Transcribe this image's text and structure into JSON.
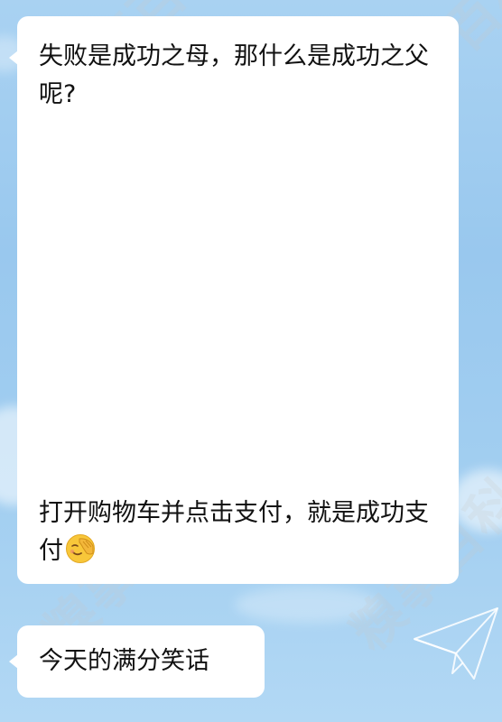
{
  "chat": {
    "messages": [
      {
        "question": "失败是成功之母，那什么是成功之父呢?",
        "answer": "打开购物车并点击支付，就是成功支付",
        "emoji": "facepalm-emoji"
      },
      {
        "text": "今天的满分笑话"
      }
    ]
  },
  "background": {
    "watermark": "糗事百科",
    "decorations": [
      "paper-plane-icon",
      "cloud"
    ]
  },
  "colors": {
    "background": "#a3cff1",
    "bubble": "#ffffff",
    "text": "#111111"
  }
}
